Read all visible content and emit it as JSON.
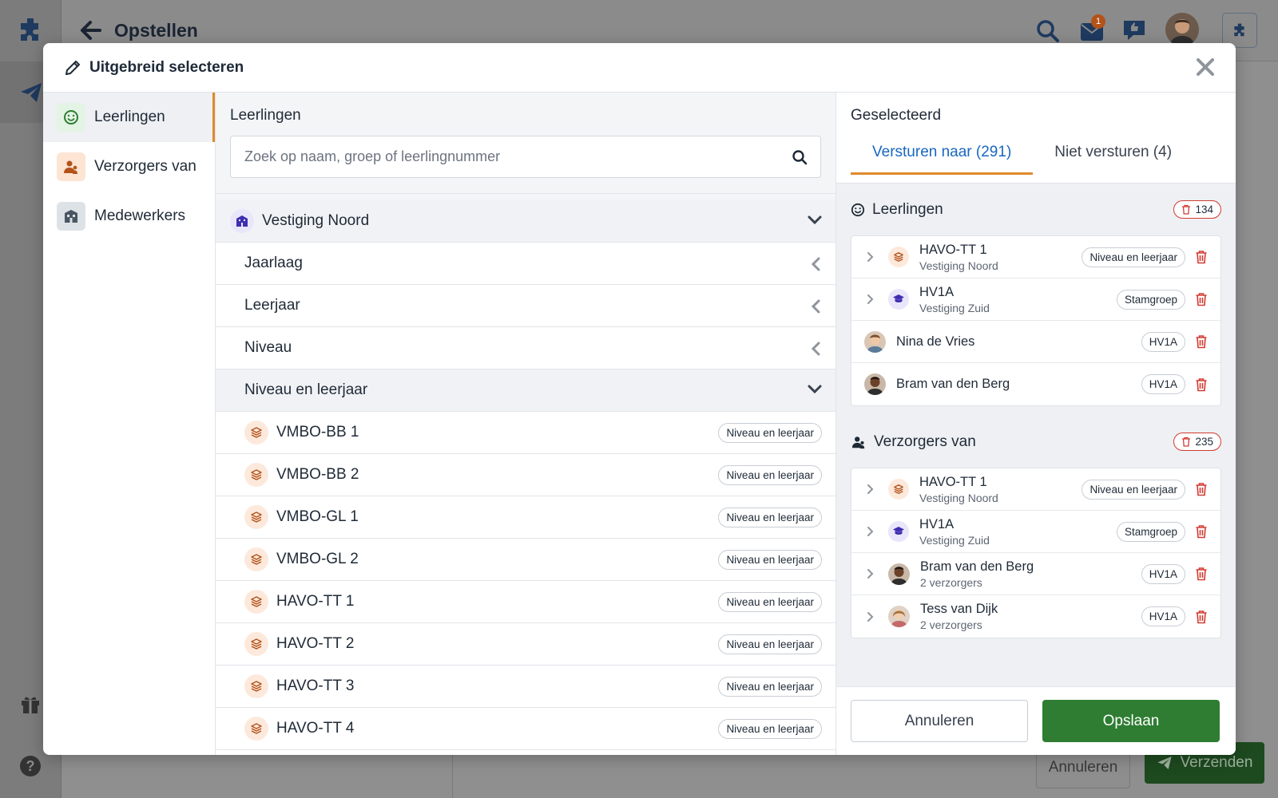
{
  "app": {
    "page_title": "Opstellen",
    "message_badge": "1",
    "bg_cancel_label": "Annuleren",
    "bg_send_label": "Verzenden"
  },
  "modal": {
    "title": "Uitgebreid selecteren",
    "categories": [
      {
        "label": "Leerlingen",
        "icon": "smiley-icon",
        "active": true
      },
      {
        "label": "Verzorgers van",
        "icon": "guardian-icon",
        "active": false
      },
      {
        "label": "Medewerkers",
        "icon": "staff-icon",
        "active": false
      }
    ],
    "middle": {
      "heading": "Leerlingen",
      "search_placeholder": "Zoek op naam, groep of leerlingnummer",
      "location": "Vestiging Noord",
      "groups": [
        {
          "label": "Jaarlaag",
          "expanded": false
        },
        {
          "label": "Leerjaar",
          "expanded": false
        },
        {
          "label": "Niveau",
          "expanded": false
        },
        {
          "label": "Niveau en leerjaar",
          "expanded": true
        }
      ],
      "items": [
        {
          "name": "VMBO-BB 1",
          "tag": "Niveau en leerjaar"
        },
        {
          "name": "VMBO-BB 2",
          "tag": "Niveau en leerjaar"
        },
        {
          "name": "VMBO-GL 1",
          "tag": "Niveau en leerjaar"
        },
        {
          "name": "VMBO-GL 2",
          "tag": "Niveau en leerjaar"
        },
        {
          "name": "HAVO-TT 1",
          "tag": "Niveau en leerjaar"
        },
        {
          "name": "HAVO-TT 2",
          "tag": "Niveau en leerjaar"
        },
        {
          "name": "HAVO-TT 3",
          "tag": "Niveau en leerjaar"
        },
        {
          "name": "HAVO-TT 4",
          "tag": "Niveau en leerjaar"
        }
      ]
    },
    "right": {
      "heading": "Geselecteerd",
      "tabs": [
        {
          "label": "Versturen naar (291)",
          "active": true
        },
        {
          "label": "Niet versturen (4)",
          "active": false
        }
      ],
      "sections": [
        {
          "name": "Leerlingen",
          "count": "134",
          "rows": [
            {
              "title": "HAVO-TT 1",
              "subtitle": "Vestiging Noord",
              "tag": "Niveau en leerjaar",
              "kind": "layers",
              "expandable": true
            },
            {
              "title": "HV1A",
              "subtitle": "Vestiging Zuid",
              "tag": "Stamgroep",
              "kind": "grad",
              "expandable": true
            },
            {
              "title": "Nina de Vries",
              "subtitle": "",
              "tag": "HV1A",
              "kind": "avatar-light",
              "expandable": false
            },
            {
              "title": "Bram van den Berg",
              "subtitle": "",
              "tag": "HV1A",
              "kind": "avatar-dark",
              "expandable": false
            }
          ]
        },
        {
          "name": "Verzorgers van",
          "count": "235",
          "rows": [
            {
              "title": "HAVO-TT 1",
              "subtitle": "Vestiging Noord",
              "tag": "Niveau en leerjaar",
              "kind": "layers",
              "expandable": true
            },
            {
              "title": "HV1A",
              "subtitle": "Vestiging Zuid",
              "tag": "Stamgroep",
              "kind": "grad",
              "expandable": true
            },
            {
              "title": "Bram van den Berg",
              "subtitle": "2 verzorgers",
              "tag": "HV1A",
              "kind": "avatar-dark",
              "expandable": true
            },
            {
              "title": "Tess van Dijk",
              "subtitle": "2 verzorgers",
              "tag": "HV1A",
              "kind": "avatar-light",
              "expandable": true
            }
          ]
        }
      ],
      "cancel_label": "Annuleren",
      "save_label": "Opslaan"
    }
  },
  "colors": {
    "accent_orange": "#e08a2c",
    "tab_blue": "#1867c0",
    "save_green": "#2e7d32",
    "trash_red": "#d23b32"
  }
}
